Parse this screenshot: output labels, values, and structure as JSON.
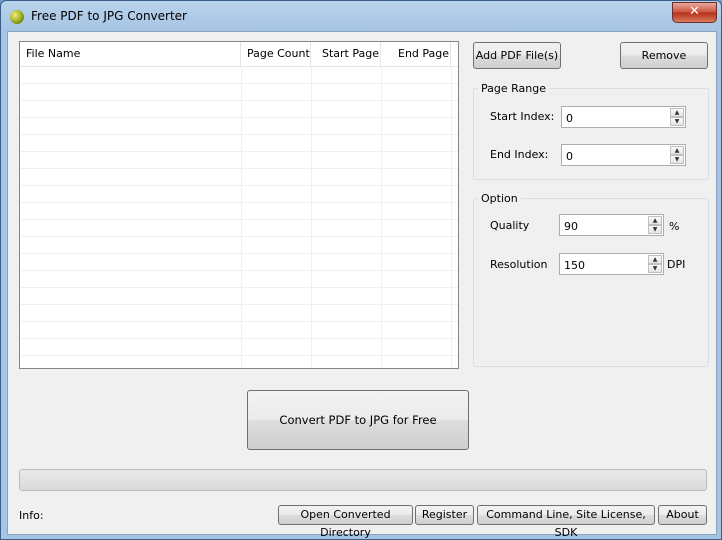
{
  "window": {
    "title": "Free PDF to JPG Converter",
    "close": "✕"
  },
  "file_list": {
    "columns": [
      "File Name",
      "Page Count",
      "Start Page",
      "End Page"
    ],
    "rows": []
  },
  "buttons": {
    "add_pdf": "Add PDF File(s)",
    "remove": "Remove",
    "convert": "Convert PDF to JPG for Free",
    "open_dir": "Open Converted Directory",
    "register": "Register",
    "cmdline": "Command Line, Site License, SDK",
    "about": "About"
  },
  "page_range": {
    "title": "Page Range",
    "start_label": "Start Index:",
    "start_value": "0",
    "end_label": "End Index:",
    "end_value": "0"
  },
  "option": {
    "title": "Option",
    "quality_label": "Quality",
    "quality_value": "90",
    "quality_unit": "%",
    "resolution_label": "Resolution",
    "resolution_value": "150",
    "resolution_unit": "DPI"
  },
  "status": {
    "info_label": "Info:",
    "progress": 0
  }
}
